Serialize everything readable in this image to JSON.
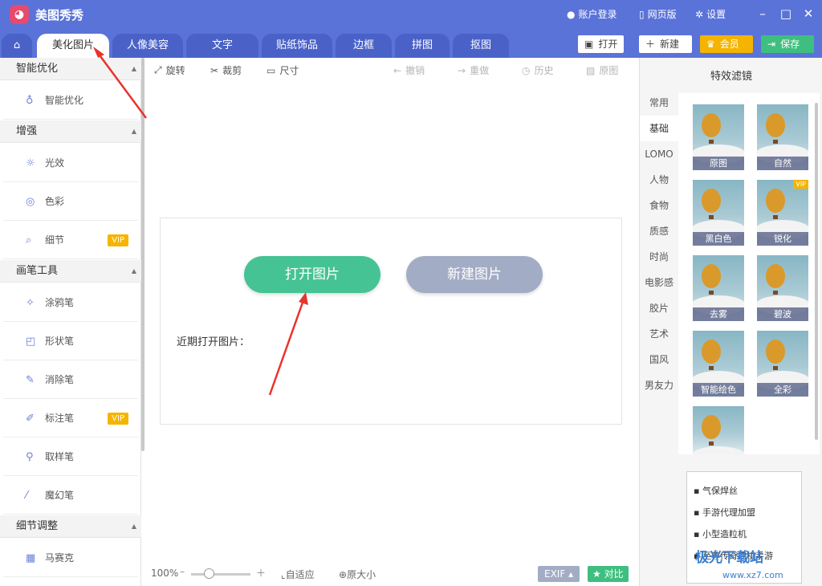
{
  "app": {
    "title": "美图秀秀"
  },
  "header": {
    "login": "账户登录",
    "web": "网页版",
    "settings": "设置"
  },
  "tabs": [
    "美化图片",
    "人像美容",
    "文字",
    "贴纸饰品",
    "边框",
    "拼图",
    "抠图"
  ],
  "toolbar_right": {
    "open": "打开",
    "new": "新建",
    "vip": "会员",
    "save": "保存"
  },
  "left_panel": {
    "sections": [
      {
        "title": "智能优化",
        "items": [
          {
            "label": "智能优化",
            "vip": false
          }
        ]
      },
      {
        "title": "增强",
        "items": [
          {
            "label": "光效",
            "vip": false
          },
          {
            "label": "色彩",
            "vip": false
          },
          {
            "label": "细节",
            "vip": true
          }
        ]
      },
      {
        "title": "画笔工具",
        "items": [
          {
            "label": "涂鸦笔",
            "vip": false
          },
          {
            "label": "形状笔",
            "vip": false
          },
          {
            "label": "消除笔",
            "vip": false
          },
          {
            "label": "标注笔",
            "vip": true
          },
          {
            "label": "取样笔",
            "vip": false
          },
          {
            "label": "魔幻笔",
            "vip": false
          }
        ]
      },
      {
        "title": "细节调整",
        "items": [
          {
            "label": "马赛克",
            "vip": false
          }
        ]
      }
    ],
    "vip_label": "VIP"
  },
  "edit_tools": {
    "rotate": "旋转",
    "crop": "裁剪",
    "size": "尺寸",
    "undo": "撤销",
    "redo": "重做",
    "history": "历史",
    "original": "原图"
  },
  "canvas": {
    "open_image": "打开图片",
    "new_image": "新建图片",
    "recent": "近期打开图片："
  },
  "bottom_bar": {
    "zoom": "100%",
    "fit": "自适应",
    "actual": "原大小",
    "exif": "EXIF",
    "compare": "对比"
  },
  "right_panel": {
    "title": "特效滤镜",
    "categories": [
      "常用",
      "基础",
      "LOMO",
      "人物",
      "食物",
      "质感",
      "时尚",
      "电影感",
      "胶片",
      "艺术",
      "国风",
      "男友力"
    ],
    "active_category": "基础",
    "filters": [
      {
        "name": "原图",
        "vip": false
      },
      {
        "name": "自然",
        "vip": false
      },
      {
        "name": "黑白色",
        "vip": false
      },
      {
        "name": "锐化",
        "vip": true
      },
      {
        "name": "去雾",
        "vip": false
      },
      {
        "name": "碧波",
        "vip": false
      },
      {
        "name": "智能绘色",
        "vip": false
      },
      {
        "name": "全彩",
        "vip": false
      },
      {
        "name": "",
        "vip": false
      }
    ]
  },
  "ad": {
    "links": [
      "气保焊丝",
      "手游代理加盟",
      "小型造粒机",
      "至尊传奇挂机手游"
    ]
  },
  "watermark": {
    "text": "极光下载站",
    "url": "www.xz7.com"
  },
  "colors": {
    "header": "#5a73d8",
    "open_btn": "#45c394",
    "new_btn": "#a3acc5",
    "vip": "#f5b400",
    "save": "#3fbf7f"
  }
}
